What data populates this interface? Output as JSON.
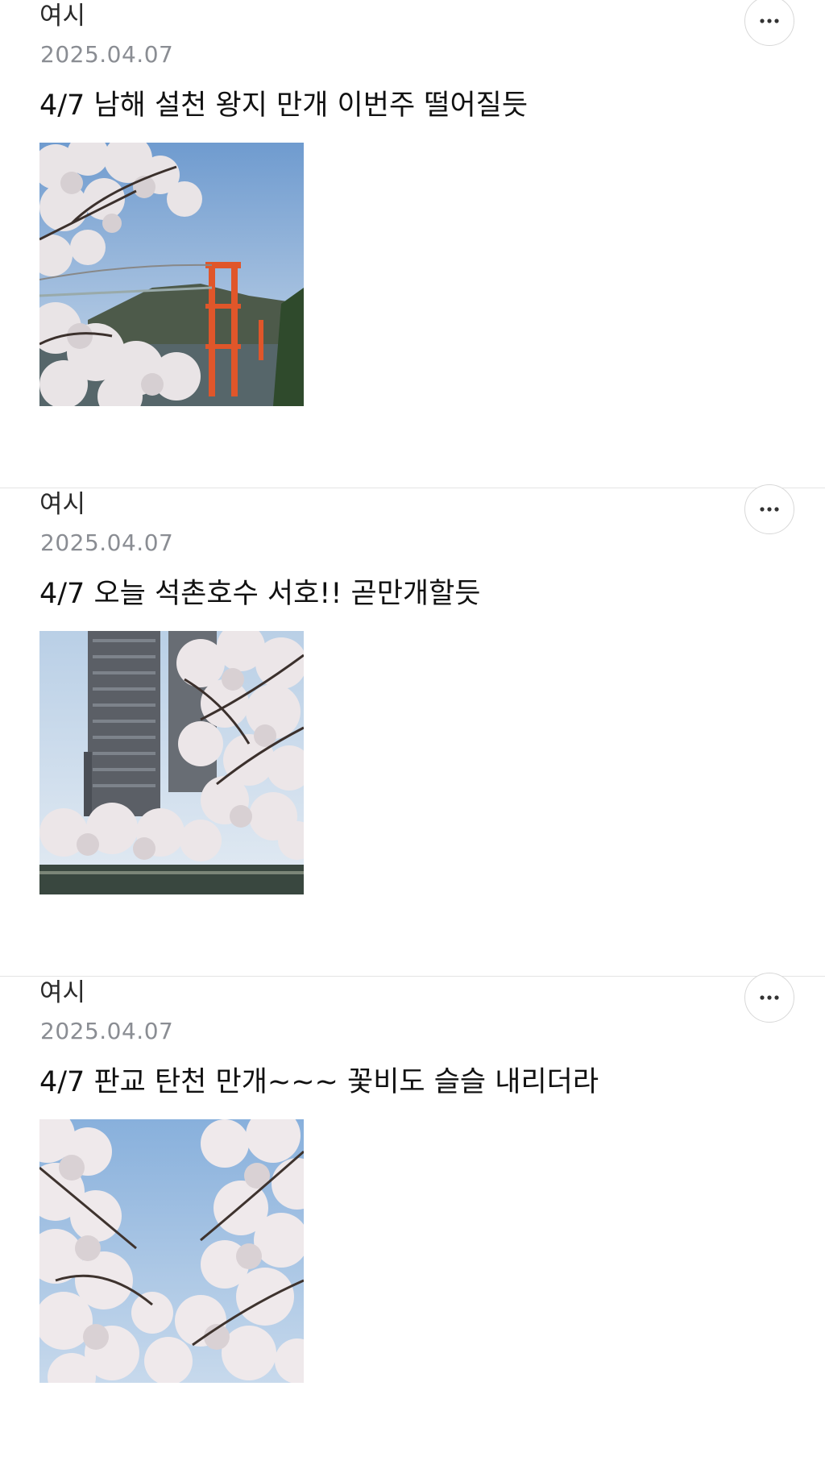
{
  "posts": [
    {
      "author": "여시",
      "date": "2025.04.07",
      "title": "4/7 남해 설천 왕지 만개 이번주 떨어질듯",
      "image": "cherry-blossom-red-suspension-bridge-photo"
    },
    {
      "author": "여시",
      "date": "2025.04.07",
      "title": "4/7 오늘 석촌호수 서호!! 곧만개할듯",
      "image": "cherry-blossom-lake-tower-photo"
    },
    {
      "author": "여시",
      "date": "2025.04.07",
      "title": "4/7 판교 탄천 만개~~~ 꽃비도 슬슬 내리더라",
      "image": "cherry-blossom-trees-sky-photo"
    }
  ],
  "icons": {
    "more": "more-horizontal-icon"
  },
  "colors": {
    "date": "#8a8d93",
    "divider": "#e4e4e4",
    "bridge": "#e0562a"
  }
}
